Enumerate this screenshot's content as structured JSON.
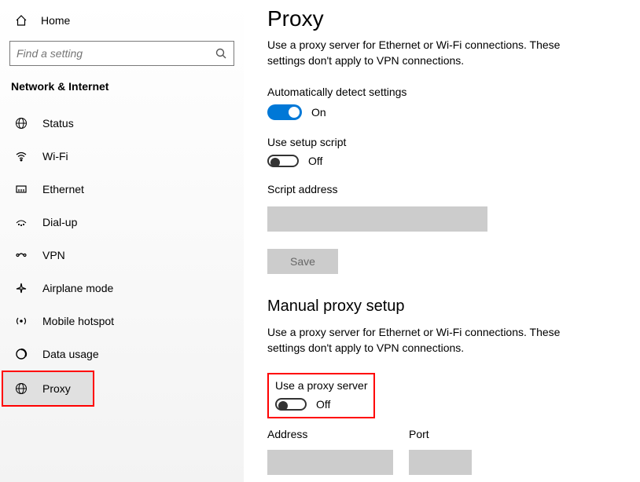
{
  "sidebar": {
    "home_label": "Home",
    "search_placeholder": "Find a setting",
    "section_title": "Network & Internet",
    "items": [
      {
        "label": "Status"
      },
      {
        "label": "Wi-Fi"
      },
      {
        "label": "Ethernet"
      },
      {
        "label": "Dial-up"
      },
      {
        "label": "VPN"
      },
      {
        "label": "Airplane mode"
      },
      {
        "label": "Mobile hotspot"
      },
      {
        "label": "Data usage"
      },
      {
        "label": "Proxy"
      }
    ]
  },
  "main": {
    "title": "Proxy",
    "desc1": "Use a proxy server for Ethernet or Wi-Fi connections. These settings don't apply to VPN connections.",
    "auto_detect_label": "Automatically detect settings",
    "auto_detect_state": "On",
    "setup_script_label": "Use setup script",
    "setup_script_state": "Off",
    "script_address_label": "Script address",
    "save_label": "Save",
    "manual_heading": "Manual proxy setup",
    "desc2": "Use a proxy server for Ethernet or Wi-Fi connections. These settings don't apply to VPN connections.",
    "use_proxy_label": "Use a proxy server",
    "use_proxy_state": "Off",
    "address_label": "Address",
    "port_label": "Port"
  }
}
